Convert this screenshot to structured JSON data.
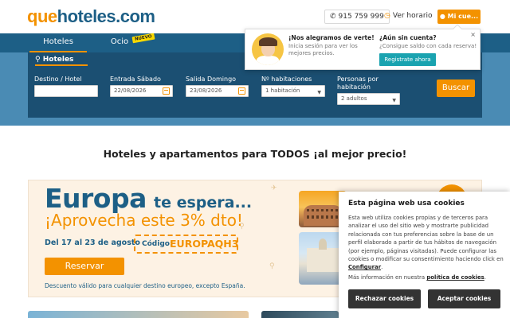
{
  "header": {
    "logo": {
      "part1": "que",
      "part2": "hoteles.com"
    },
    "phone": "915 759 999",
    "horario": "Ver horario",
    "account": "Mi cue..."
  },
  "nav": {
    "tabs": [
      {
        "label": "Hoteles"
      },
      {
        "label": "Ocio"
      }
    ],
    "badge": "NUEVO"
  },
  "search": {
    "heading": "Hoteles",
    "destino_label": "Destino / Hotel",
    "destino_value": "",
    "entrada_label": "Entrada Sábado",
    "entrada_value": "22/08/2026",
    "salida_label": "Salida Domingo",
    "salida_value": "23/08/2026",
    "habitaciones_label": "Nº habitaciones",
    "habitaciones_value": "1 habitación",
    "personas_label_1": "Personas por",
    "personas_label_2": "habitación",
    "personas_value": "2 adultos",
    "button": "Buscar"
  },
  "popup": {
    "left_title": "¡Nos alegramos de verte!",
    "left_text_1": "Inicia sesión para ver los",
    "left_text_2": "mejores precios.",
    "right_title": "¿Aún sin cuenta?",
    "right_text": "¿Consigue saldo con cada reserva!",
    "button": "Registrate ahora",
    "close": "×"
  },
  "headline": "Hoteles y apartamentos para TODOS ¡al mejor precio!",
  "promo": {
    "title": "Europa",
    "title2": "te espera...",
    "subtitle": "¡Aprovecha este 3% dto!",
    "dates": "Del 17 al 23 de agosto",
    "code_label": "Código:",
    "code_value": "EUROPAQH3",
    "button": "Reservar",
    "disclaimer": "Descuento válido para cualquier destino europeo, excepto España."
  },
  "cookies": {
    "title": "Esta página web usa cookies",
    "body": "Esta web utiliza cookies propias y de terceros para analizar el uso del sitio web y mostrarte publicidad relacionada con tus preferencias sobre la base de un perfil elaborado a partir de tus hábitos de navegación (por ejemplo, páginas visitadas). Puede configurar las cookies o modificar su consentimiento haciendo click en",
    "config_link": "Configurar",
    "more_prefix": "Más información en nuestra",
    "policy_link": "política de cookies",
    "reject": "Rechazar cookies",
    "accept": "Aceptar cookies"
  },
  "colors": {
    "brand_orange": "#f39200",
    "brand_blue": "#1d5f86",
    "search_bg": "#1b4f72",
    "teal": "#1aa3b0"
  },
  "icons": [
    "phone-icon",
    "clock-icon",
    "user-icon",
    "search-icon",
    "calendar-icon",
    "chevron-down-icon",
    "close-icon"
  ]
}
